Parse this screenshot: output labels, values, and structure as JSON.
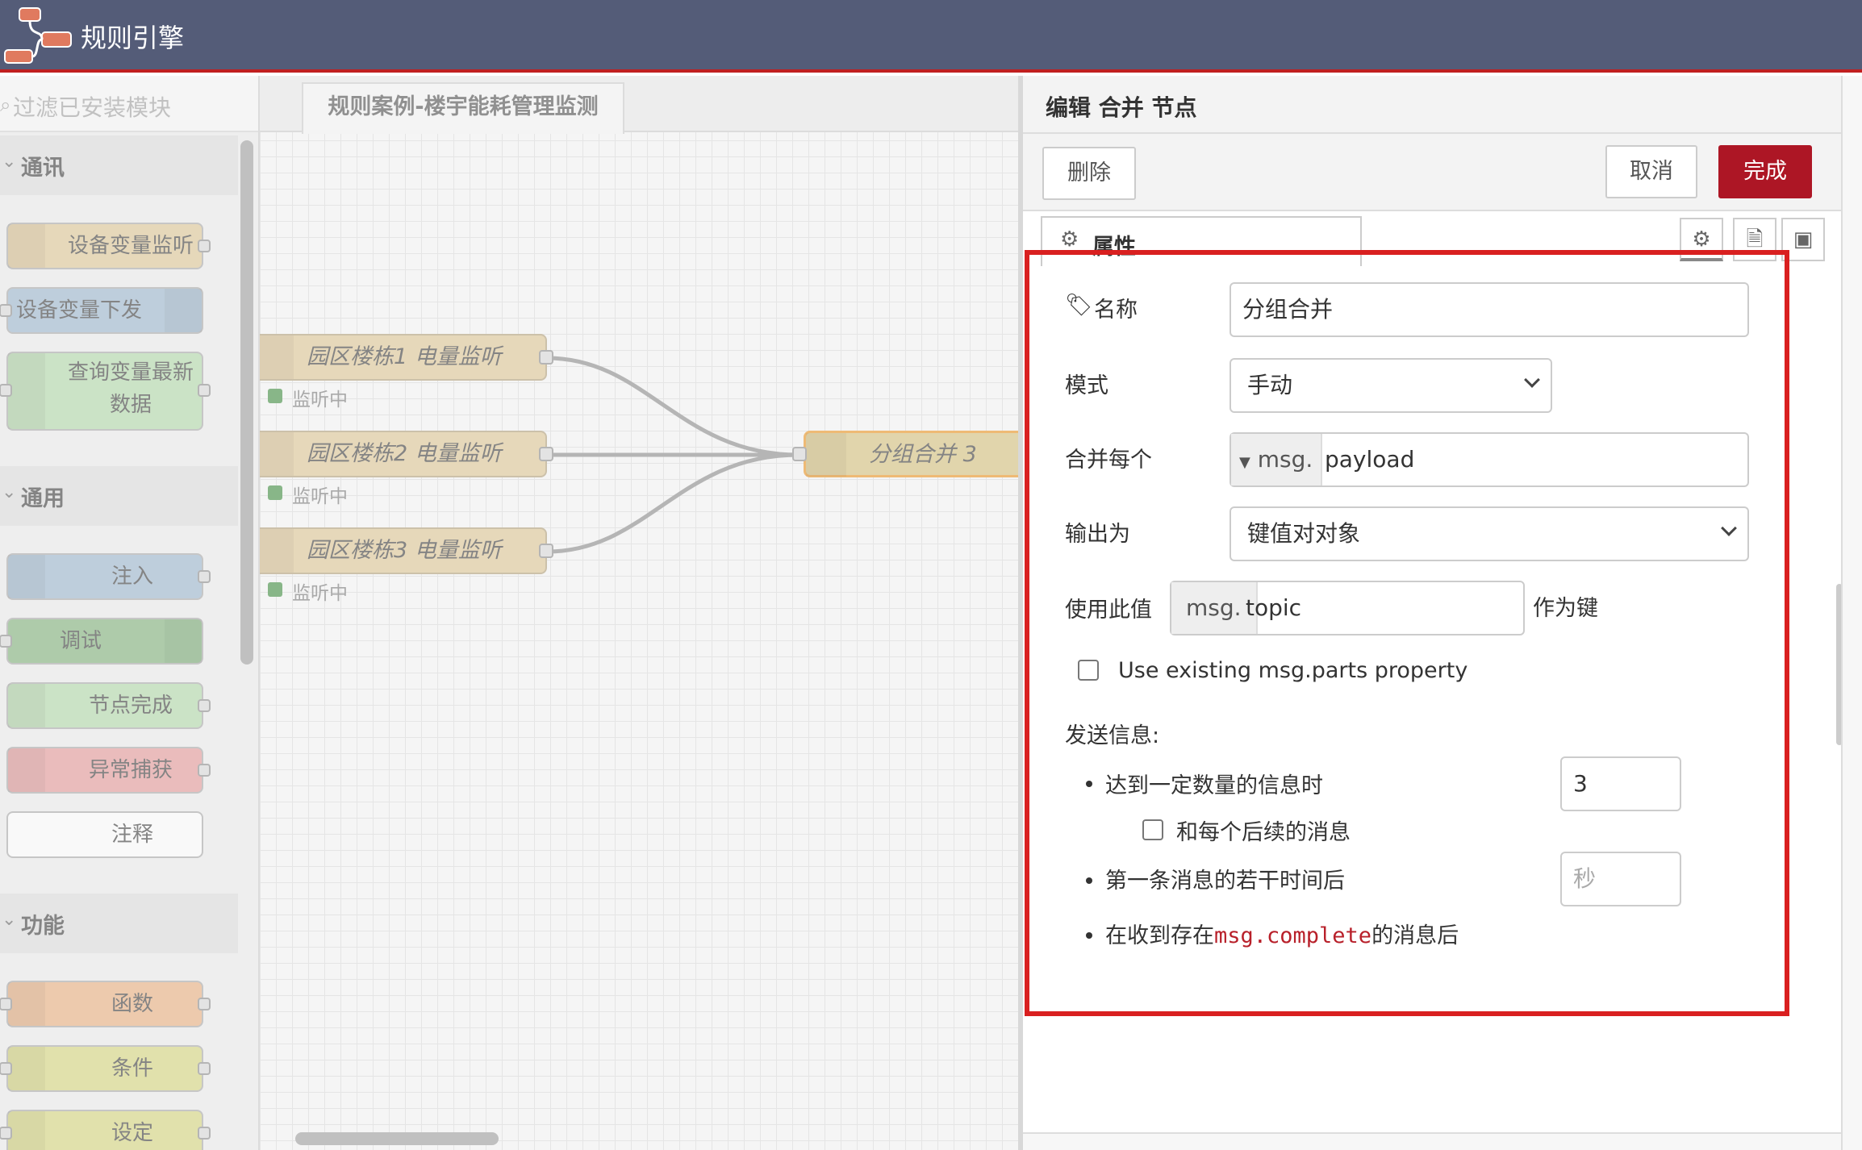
{
  "header": {
    "title": "规则引擎"
  },
  "palette": {
    "search_placeholder": "过滤已安装模块",
    "categories": [
      {
        "label": "通讯",
        "nodes": [
          "设备变量监听",
          "设备变量下发",
          "查询变量最新",
          "数据"
        ]
      },
      {
        "label": "通用",
        "nodes": [
          "注入",
          "调试",
          "节点完成",
          "异常捕获",
          "注释"
        ]
      },
      {
        "label": "功能",
        "nodes": [
          "函数",
          "条件",
          "设定"
        ]
      }
    ],
    "colors": {
      "device": "#ddc9a0",
      "blue": "#a6bbcf",
      "green": "#b7d8b0",
      "red": "#e2a3a3",
      "orange": "#e6b68e",
      "yellow": "#d6d68c"
    }
  },
  "workspace": {
    "tab": "规则案例-楼宇能耗管理监测",
    "nodes": [
      {
        "label": "园区楼栋1 电量监听",
        "status": "监听中"
      },
      {
        "label": "园区楼栋2 电量监听",
        "status": "监听中"
      },
      {
        "label": "园区楼栋3 电量监听",
        "status": "监听中"
      }
    ],
    "join_node": "分组合并 3"
  },
  "tray": {
    "title": "编辑 合并 节点",
    "delete_label": "删除",
    "cancel_label": "取消",
    "done_label": "完成",
    "tab_props": "属性",
    "form": {
      "name_label": "名称",
      "name_value": "分组合并",
      "mode_label": "模式",
      "mode_value": "手动",
      "combine_label": "合并每个",
      "combine_prefix": "msg.",
      "combine_value": "payload",
      "output_label": "输出为",
      "output_value": "键值对对象",
      "key_label": "使用此值",
      "key_prefix": "msg.",
      "key_value": "topic",
      "key_suffix": "作为键",
      "use_parts_label": "Use existing msg.parts property",
      "send_label": "发送信息:",
      "count_label": "达到一定数量的信息时",
      "count_value": "3",
      "subsequent_label": "和每个后续的消息",
      "timeout_label": "第一条消息的若干时间后",
      "timeout_placeholder": "秒",
      "complete_prefix": "在收到存在",
      "complete_code": "msg.complete",
      "complete_suffix": "的消息后"
    },
    "accent": "#ad1625",
    "highlight": "#d92020"
  }
}
